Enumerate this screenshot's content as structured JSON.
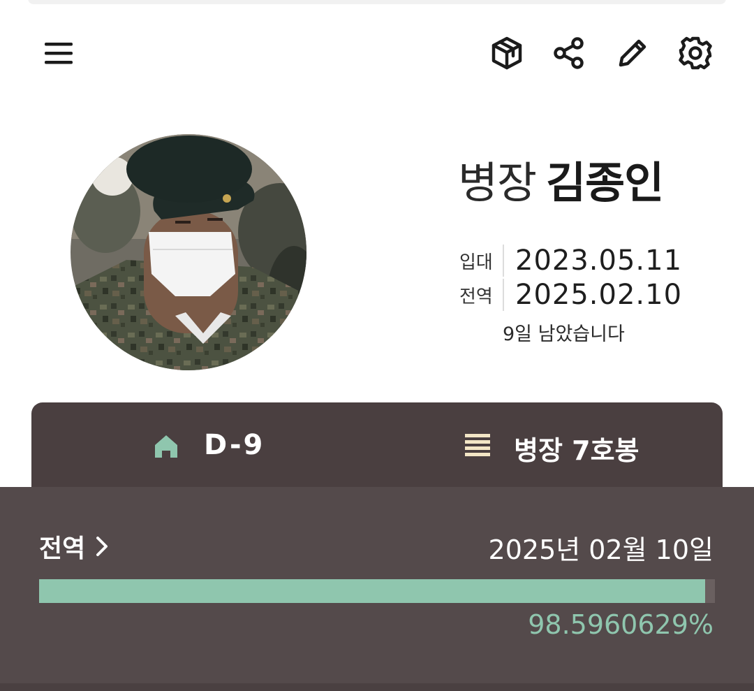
{
  "profile": {
    "rank": "병장",
    "name": "김종인",
    "enlist_label": "입대",
    "enlist_date": "2023.05.11",
    "discharge_label": "전역",
    "discharge_date": "2025.02.10",
    "remaining_text": "9일 남았습니다"
  },
  "summary_card": {
    "dday": "D-9",
    "rank_pay": "병장 7호봉"
  },
  "discharge_panel": {
    "label": "전역",
    "date_text": "2025년 02월 10일",
    "progress_text": "98.5960629%",
    "progress_fraction": 0.985960629
  },
  "icons": {
    "menu": "menu-icon",
    "box": "package-icon",
    "share": "share-icon",
    "edit": "pencil-icon",
    "settings": "gear-icon",
    "home": "home-icon",
    "list": "list-icon",
    "chevron": "chevron-right-icon"
  },
  "colors": {
    "card_bg": "#4a3f40",
    "panel_bg": "#544a4b",
    "accent_green": "#8fc6ae",
    "list_icon": "#f3e6c6"
  }
}
